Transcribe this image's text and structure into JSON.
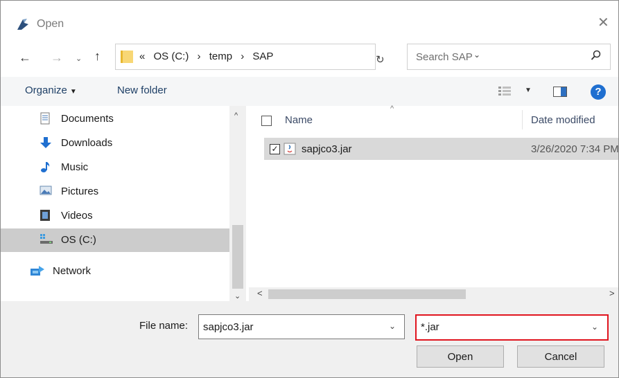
{
  "window": {
    "title": "Open",
    "close_glyph": "✕",
    "icon": "app-icon"
  },
  "nav": {
    "back_glyph": "←",
    "forward_glyph": "→",
    "recent_glyph": "⌄",
    "up_glyph": "↑",
    "breadcrumbs": [
      "«",
      "OS (C:)",
      "›",
      "temp",
      "›",
      "SAP"
    ],
    "dropdown_glyph": "⌄",
    "refresh_glyph": "↻",
    "search_placeholder": "Search SAP"
  },
  "toolbar": {
    "organize_label": "Organize",
    "organize_caret": "▼",
    "new_folder_label": "New folder",
    "view_caret": "▼",
    "help_glyph": "?"
  },
  "sidebar": {
    "items": [
      {
        "label": "Documents",
        "icon": "documents-icon"
      },
      {
        "label": "Downloads",
        "icon": "downloads-icon"
      },
      {
        "label": "Music",
        "icon": "music-icon"
      },
      {
        "label": "Pictures",
        "icon": "pictures-icon"
      },
      {
        "label": "Videos",
        "icon": "videos-icon"
      },
      {
        "label": "OS (C:)",
        "icon": "drive-icon",
        "selected": true
      },
      {
        "label": "Network",
        "icon": "network-icon"
      }
    ],
    "scroll_up_glyph": "^",
    "scroll_down_glyph": "⌄"
  },
  "filelist": {
    "columns": {
      "name": "Name",
      "date": "Date modified"
    },
    "sort_glyph": "^",
    "rows": [
      {
        "name": "sapjco3.jar",
        "date": "3/26/2020 7:34 PM",
        "checked": true,
        "check_glyph": "✓"
      }
    ],
    "scroll_left_glyph": "<",
    "scroll_right_glyph": ">"
  },
  "footer": {
    "file_name_label": "File name:",
    "file_name_value": "sapjco3.jar",
    "filter_value": "*.jar",
    "dropdown_glyph": "⌄",
    "open_label": "Open",
    "cancel_label": "Cancel",
    "highlight_color": "#e0141e"
  },
  "colors": {
    "accent": "#1f6fd0",
    "selection": "#cccccc"
  }
}
